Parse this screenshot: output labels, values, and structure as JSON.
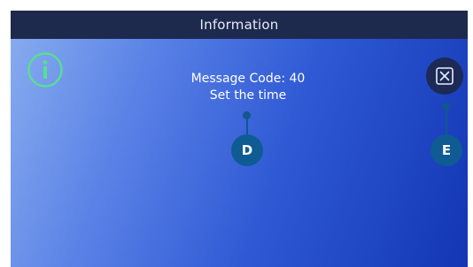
{
  "window": {
    "title": "Information"
  },
  "message": {
    "line1": "Message Code: 40",
    "line2": "Set the time"
  },
  "icons": {
    "info": "info-icon",
    "close": "close-icon"
  },
  "callouts": {
    "d": "D",
    "e": "E"
  },
  "colors": {
    "title_bar": "#1d2a4e",
    "info_icon": "#57e08f",
    "close_button": "#1c2a55",
    "callout": "#0f5b93"
  }
}
